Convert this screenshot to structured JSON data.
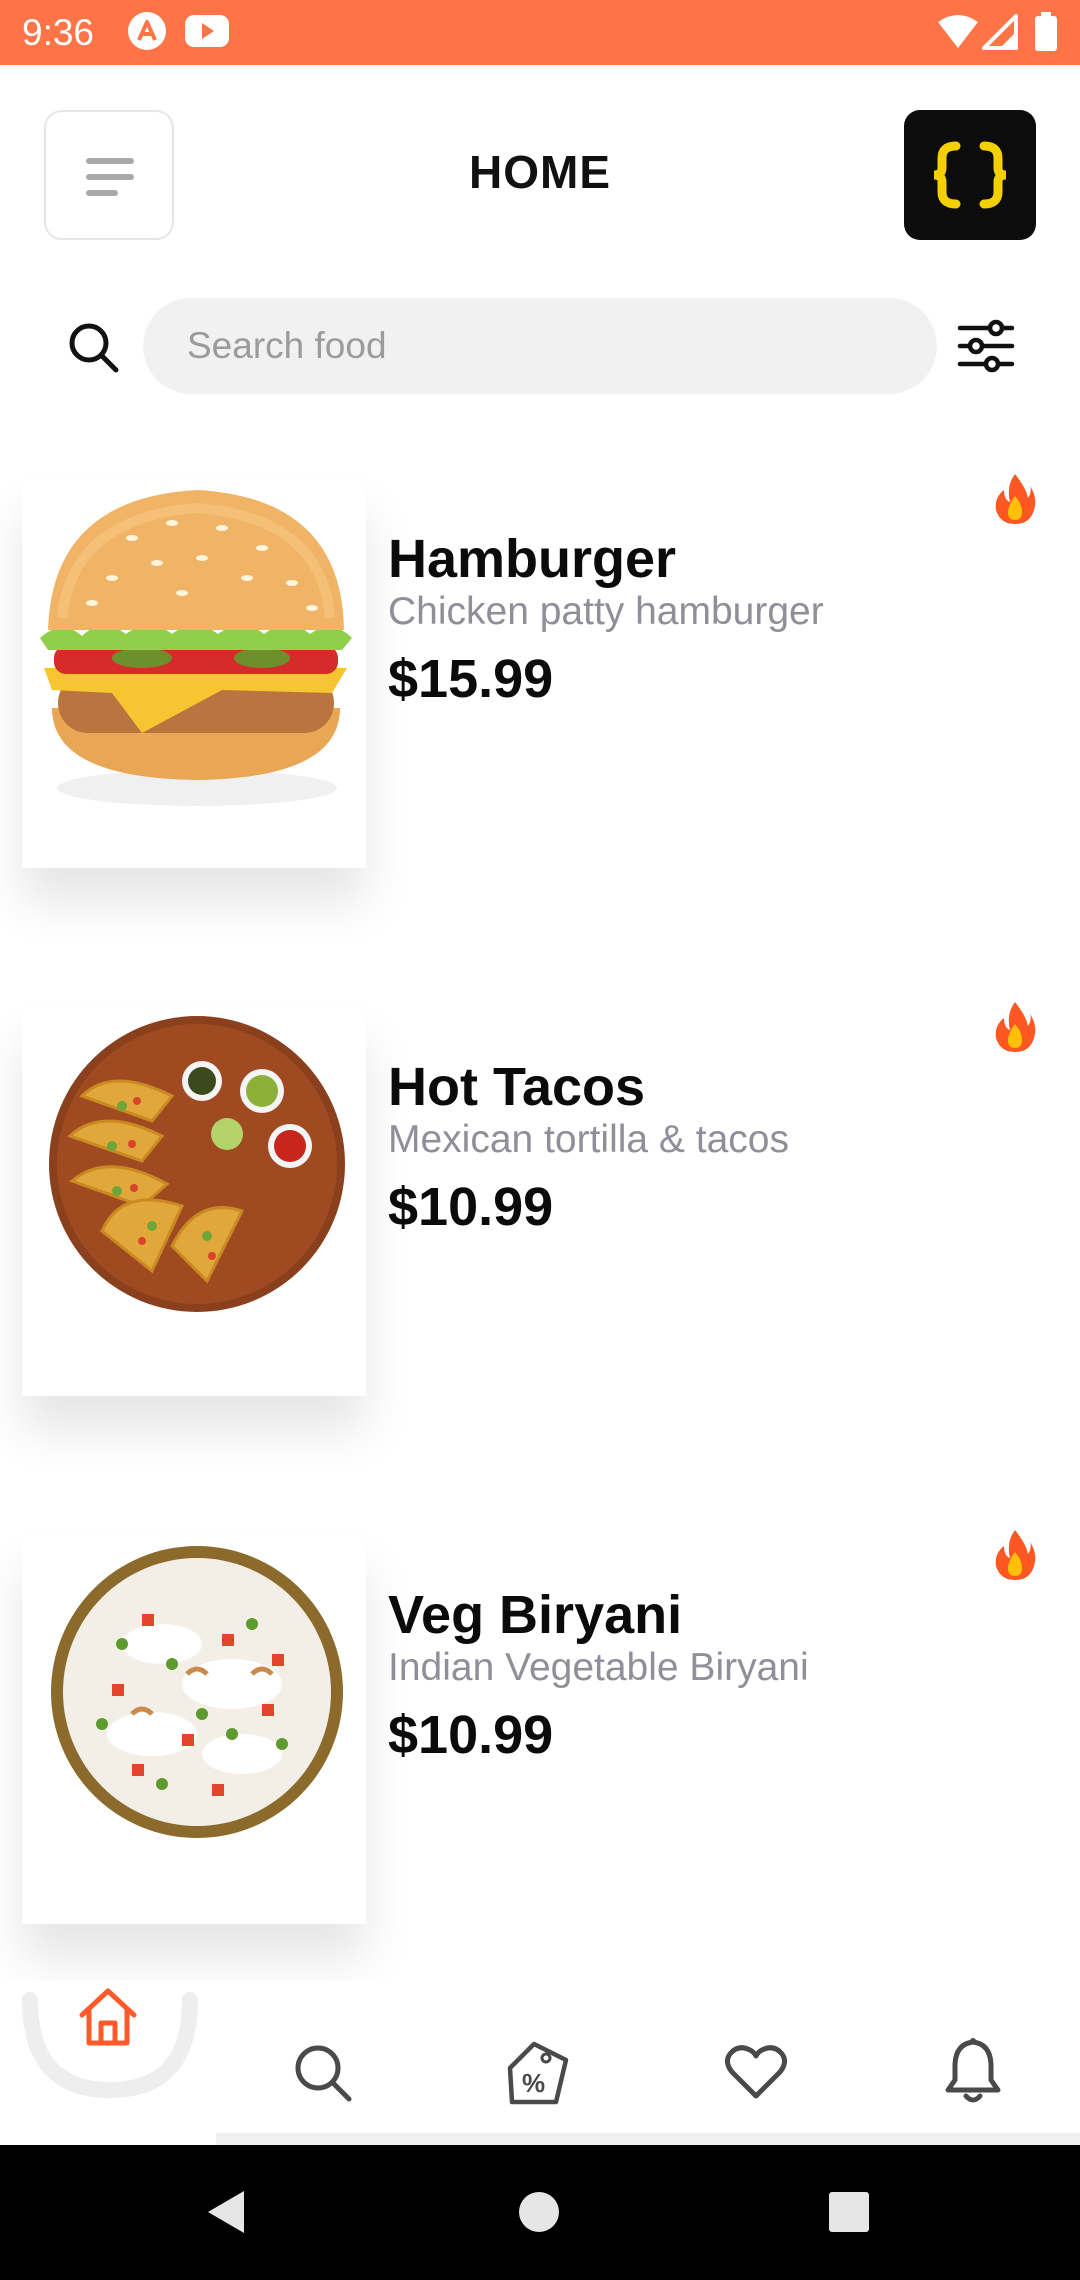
{
  "status_bar": {
    "time": "9:36",
    "left_icons": [
      "app-a-icon",
      "youtube-icon"
    ],
    "right_icons": [
      "wifi-icon",
      "cell-signal-icon",
      "battery-icon"
    ],
    "background": "#ff7447"
  },
  "header": {
    "title": "HOME",
    "menu_icon": "menu-lines-icon",
    "right_icon": "code-braces-icon",
    "right_icon_color": "#f5d000"
  },
  "search": {
    "placeholder": "Search food",
    "value": ""
  },
  "foods": [
    {
      "name": "Hamburger",
      "description": "Chicken patty hamburger",
      "price": "$15.99",
      "badge_icon": "fire-icon"
    },
    {
      "name": "Hot Tacos",
      "description": "Mexican tortilla & tacos",
      "price": "$10.99",
      "badge_icon": "fire-icon"
    },
    {
      "name": "Veg Biryani",
      "description": "Indian Vegetable Biryani",
      "price": "$10.99",
      "badge_icon": "fire-icon"
    }
  ],
  "bottom_nav": {
    "items": [
      "home-icon",
      "search-icon",
      "discount-tag-icon",
      "heart-icon",
      "bell-icon"
    ],
    "active": "home-icon",
    "active_color": "#ff5a2c"
  },
  "system_nav": [
    "back-icon",
    "home-circle-icon",
    "recents-icon"
  ]
}
